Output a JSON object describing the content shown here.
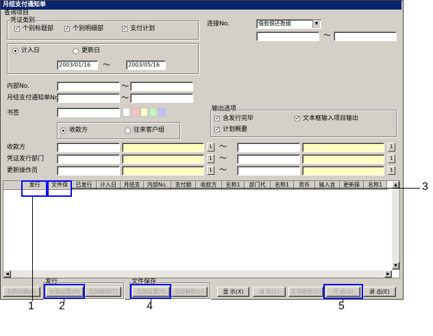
{
  "window": {
    "title": "月结支付通知单"
  },
  "query": {
    "group_label": "查询项目",
    "voucher_group": "凭证类别",
    "checks": [
      {
        "label": "个别标题部",
        "checked": true
      },
      {
        "label": "个别明细部",
        "checked": true
      },
      {
        "label": "支付计划",
        "checked": true
      }
    ],
    "date_mode": [
      {
        "label": "计入日",
        "selected": true
      },
      {
        "label": "更新日",
        "selected": false
      }
    ],
    "date_from": "2003/01/16",
    "date_sep": "～",
    "date_to": "2003/05/16",
    "connect_label": "连接No.",
    "connect_value": "借款偿还数据",
    "range_sep": "～",
    "internal_label": "内部No.",
    "notice_label": "月结支付通知单No.",
    "bookmark_label": "书签",
    "payee_mode": [
      {
        "label": "收款方",
        "selected": true
      },
      {
        "label": "往来客户组",
        "selected": false
      }
    ],
    "rows": [
      {
        "label": "收款方",
        "btn": "1"
      },
      {
        "label": "凭证发行部门",
        "btn": "1"
      },
      {
        "label": "更新操作员",
        "btn": "1"
      }
    ]
  },
  "output": {
    "group_label": "输出选项",
    "checks": [
      {
        "label": "含发行完毕",
        "checked": true
      },
      {
        "label": "文本框输入项目输出",
        "checked": true
      },
      {
        "label": "计划概要",
        "checked": true
      }
    ]
  },
  "grid": {
    "columns": [
      "发行",
      "文件保",
      "已发行",
      "计入日",
      "月结支",
      "内部No.",
      "支付额",
      "收款方",
      "名称1",
      "部门代",
      "名称1",
      "货币",
      "输入含",
      "更新操",
      "名称1"
    ]
  },
  "bottom": {
    "name_switch": "名称切换(K)",
    "issue_group": "发行",
    "issue_set_all": "全部设置(M)",
    "issue_clear_all": "全部解除(T)",
    "save_group": "文件保存",
    "save_set_all": "全部设置(Y)",
    "save_clear_all": "全部解除(U)",
    "display": "显  示(X)",
    "clear": "清  除(C)",
    "text_change": "文书变更(O)",
    "start": "开  始(A)",
    "exit": "退  出(E)"
  },
  "callouts": [
    "1",
    "2",
    "3",
    "4",
    "5"
  ],
  "colors": {
    "highlight": "#0000ff",
    "title_bar": "#0a246a",
    "yellow_field": "#ffffc0"
  }
}
